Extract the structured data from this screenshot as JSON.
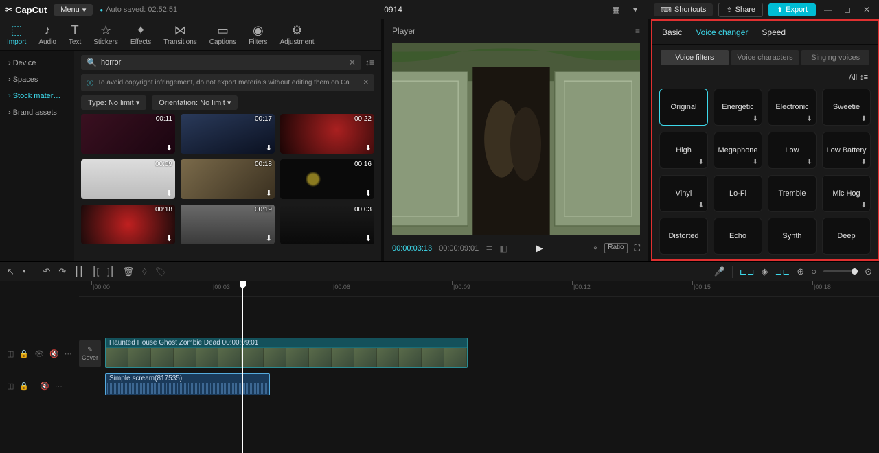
{
  "titlebar": {
    "brand": "CapCut",
    "menu": "Menu",
    "autosave": "Auto saved: 02:52:51",
    "project": "0914",
    "shortcuts": "Shortcuts",
    "share": "Share",
    "export": "Export"
  },
  "tool_tabs": [
    {
      "label": "Import",
      "active": true
    },
    {
      "label": "Audio"
    },
    {
      "label": "Text"
    },
    {
      "label": "Stickers"
    },
    {
      "label": "Effects"
    },
    {
      "label": "Transitions"
    },
    {
      "label": "Captions"
    },
    {
      "label": "Filters"
    },
    {
      "label": "Adjustment"
    }
  ],
  "side_nav": [
    {
      "label": "Device"
    },
    {
      "label": "Spaces"
    },
    {
      "label": "Stock mater…",
      "active": true
    },
    {
      "label": "Brand assets"
    }
  ],
  "search": {
    "value": "horror"
  },
  "warning": "To avoid copyright infringement, do not export materials without editing them on Ca",
  "filters": {
    "type": "Type: No limit",
    "orientation": "Orientation: No limit"
  },
  "thumbs": [
    {
      "time": "00:11",
      "bg": "linear-gradient(135deg,#3a1020,#1a0510)"
    },
    {
      "time": "00:17",
      "bg": "linear-gradient(160deg,#2a3a5a,#0a1020)"
    },
    {
      "time": "00:22",
      "bg": "radial-gradient(circle at 60% 40%,#aa2020,#1a0505)"
    },
    {
      "time": "00:09",
      "bg": "linear-gradient(#ddd,#bbb)"
    },
    {
      "time": "00:18",
      "bg": "linear-gradient(135deg,#7a6a4a,#3a3020)"
    },
    {
      "time": "00:16",
      "bg": "radial-gradient(circle at 35% 50%,#8a7a20 8%,#0a0a0a 12%),radial-gradient(circle at 65% 50%,#8a7a20 8%,#0a0a0a 12%)"
    },
    {
      "time": "00:18",
      "bg": "radial-gradient(circle,#c02020,#1a0a0a)"
    },
    {
      "time": "00:19",
      "bg": "linear-gradient(#6a6a6a,#3a3a3a)"
    },
    {
      "time": "00:03",
      "bg": "linear-gradient(#1a1a1a,#0a0a0a)"
    }
  ],
  "player": {
    "title": "Player",
    "current": "00:00:03:13",
    "total": "00:00:09:01",
    "ratio": "Ratio"
  },
  "right_panel": {
    "tabs": [
      {
        "label": "Basic"
      },
      {
        "label": "Voice changer",
        "active": true
      },
      {
        "label": "Speed"
      }
    ],
    "subtabs": [
      {
        "label": "Voice filters",
        "active": true
      },
      {
        "label": "Voice characters"
      },
      {
        "label": "Singing voices"
      }
    ],
    "all": "All",
    "voices": [
      {
        "label": "Original",
        "selected": true
      },
      {
        "label": "Energetic",
        "dl": true
      },
      {
        "label": "Electronic",
        "dl": true
      },
      {
        "label": "Sweetie",
        "dl": true
      },
      {
        "label": "High",
        "dl": true
      },
      {
        "label": "Megaphone",
        "dl": true
      },
      {
        "label": "Low",
        "dl": true
      },
      {
        "label": "Low Battery",
        "dl": true
      },
      {
        "label": "Vinyl",
        "dl": true
      },
      {
        "label": "Lo-Fi"
      },
      {
        "label": "Tremble"
      },
      {
        "label": "Mic Hog",
        "dl": true
      },
      {
        "label": "Distorted"
      },
      {
        "label": "Echo"
      },
      {
        "label": "Synth"
      },
      {
        "label": "Deep"
      }
    ]
  },
  "ruler": [
    "|00:00",
    "|00:03",
    "|00:06",
    "|00:09",
    "|00:12",
    "|00:15",
    "|00:18"
  ],
  "timeline": {
    "cover": "Cover",
    "video_clip": "Haunted House Ghost Zombie Dead   00:00:09:01",
    "audio_clip": "Simple scream(817535)"
  }
}
